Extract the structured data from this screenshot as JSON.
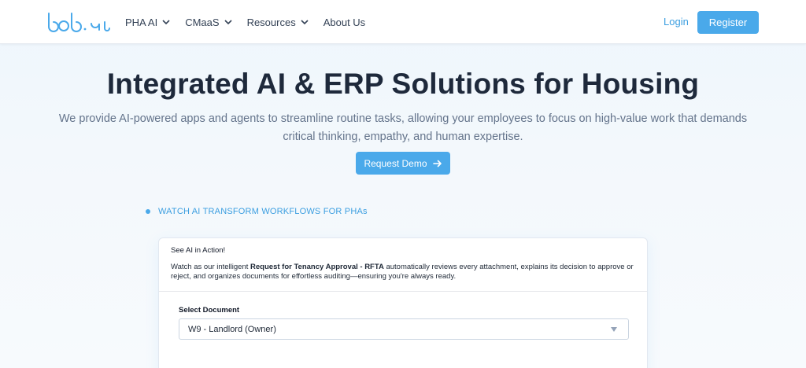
{
  "header": {
    "logo_text": "bob.ai",
    "nav": [
      {
        "label": "PHA AI",
        "has_dropdown": true
      },
      {
        "label": "CMaaS",
        "has_dropdown": true
      },
      {
        "label": "Resources",
        "has_dropdown": true
      },
      {
        "label": "About Us",
        "has_dropdown": false
      }
    ],
    "login_label": "Login",
    "register_label": "Register"
  },
  "hero": {
    "title": "Integrated AI & ERP Solutions for Housing",
    "subtitle": "We provide AI-powered apps and agents to streamline routine tasks, allowing your employees to focus on high-value work that demands critical thinking, empathy, and human expertise.",
    "demo_button_label": "Request Demo"
  },
  "watch": {
    "label": "WATCH AI TRANSFORM WORKFLOWS FOR PHAs"
  },
  "card": {
    "title": "See AI in Action!",
    "desc_prefix": "Watch as our intelligent ",
    "desc_bold": "Request for Tenancy Approval - RFTA",
    "desc_suffix": " automatically reviews every attachment, explains its decision to approve or reject, and organizes documents for effortless auditing—ensuring you're always ready.",
    "select_label": "Select Document",
    "select_value": "W9 - Landlord (Owner)"
  },
  "colors": {
    "accent": "#4aa9ea",
    "link": "#3b9ee0",
    "title": "#1e293b",
    "muted": "#64748b"
  },
  "icons": {
    "nav_dropdown": "chevron-down-icon",
    "demo_arrow": "arrow-right-icon",
    "select_caret": "caret-down-icon"
  }
}
